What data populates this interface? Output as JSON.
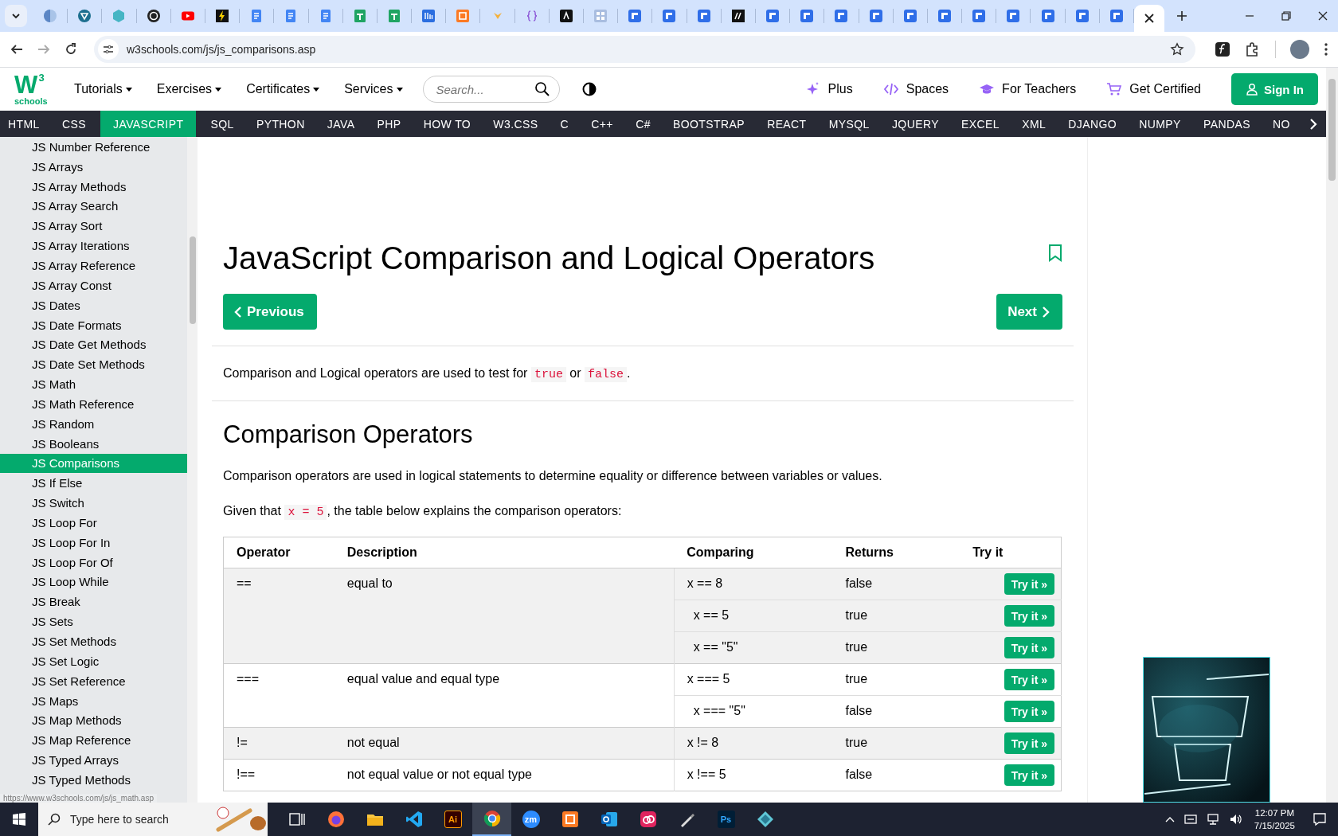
{
  "browser": {
    "tabs": [
      {
        "kind": "globe",
        "selected": false
      },
      {
        "kind": "vpn",
        "selected": false
      },
      {
        "kind": "hex",
        "selected": false
      },
      {
        "kind": "openai",
        "selected": false
      },
      {
        "kind": "youtube",
        "selected": false
      },
      {
        "kind": "bolt",
        "selected": false
      },
      {
        "kind": "doc",
        "selected": false
      },
      {
        "kind": "doc",
        "selected": false
      },
      {
        "kind": "doc",
        "selected": false
      },
      {
        "kind": "sheet",
        "selected": false
      },
      {
        "kind": "sheet",
        "selected": false
      },
      {
        "kind": "mblue",
        "selected": false
      },
      {
        "kind": "xampp",
        "selected": false
      },
      {
        "kind": "fox",
        "selected": false
      },
      {
        "kind": "braces",
        "selected": false
      },
      {
        "kind": "aiblack",
        "selected": false
      },
      {
        "kind": "repo",
        "selected": false
      },
      {
        "kind": "form",
        "selected": false
      },
      {
        "kind": "form",
        "selected": false
      },
      {
        "kind": "form",
        "selected": false
      },
      {
        "kind": "mblack",
        "selected": false
      },
      {
        "kind": "form",
        "selected": false
      },
      {
        "kind": "form",
        "selected": false
      },
      {
        "kind": "form",
        "selected": false
      },
      {
        "kind": "form",
        "selected": false
      },
      {
        "kind": "form",
        "selected": false
      },
      {
        "kind": "form",
        "selected": false
      },
      {
        "kind": "form",
        "selected": false
      },
      {
        "kind": "form",
        "selected": false
      },
      {
        "kind": "form",
        "selected": false
      },
      {
        "kind": "form",
        "selected": false
      },
      {
        "kind": "form",
        "selected": false
      },
      {
        "kind": "blank",
        "selected": true
      }
    ],
    "url": "w3schools.com/js/js_comparisons.asp"
  },
  "site_header": {
    "logo": {
      "letter": "W",
      "superscript": "3",
      "wordmark": "schools"
    },
    "menus": [
      "Tutorials",
      "Exercises",
      "Certificates",
      "Services"
    ],
    "search": {
      "placeholder": "Search..."
    },
    "links": [
      {
        "kind": "plus",
        "label": "Plus"
      },
      {
        "kind": "spaces",
        "label": "Spaces"
      },
      {
        "kind": "teachers",
        "label": "For Teachers"
      },
      {
        "kind": "certified",
        "label": "Get Certified"
      }
    ],
    "sign_in": "Sign In"
  },
  "topnav": [
    {
      "label": "HTML",
      "selected": false
    },
    {
      "label": "CSS",
      "selected": false
    },
    {
      "label": "JAVASCRIPT",
      "selected": true
    },
    {
      "label": "SQL",
      "selected": false
    },
    {
      "label": "PYTHON",
      "selected": false
    },
    {
      "label": "JAVA",
      "selected": false
    },
    {
      "label": "PHP",
      "selected": false
    },
    {
      "label": "HOW TO",
      "selected": false
    },
    {
      "label": "W3.CSS",
      "selected": false
    },
    {
      "label": "C",
      "selected": false
    },
    {
      "label": "C++",
      "selected": false
    },
    {
      "label": "C#",
      "selected": false
    },
    {
      "label": "BOOTSTRAP",
      "selected": false
    },
    {
      "label": "REACT",
      "selected": false
    },
    {
      "label": "MYSQL",
      "selected": false
    },
    {
      "label": "JQUERY",
      "selected": false
    },
    {
      "label": "EXCEL",
      "selected": false
    },
    {
      "label": "XML",
      "selected": false
    },
    {
      "label": "DJANGO",
      "selected": false
    },
    {
      "label": "NUMPY",
      "selected": false
    },
    {
      "label": "PANDAS",
      "selected": false
    },
    {
      "label": "NO",
      "selected": false
    }
  ],
  "sidebar": [
    {
      "label": "JS Number Reference",
      "selected": false
    },
    {
      "label": "JS Arrays",
      "selected": false
    },
    {
      "label": "JS Array Methods",
      "selected": false
    },
    {
      "label": "JS Array Search",
      "selected": false
    },
    {
      "label": "JS Array Sort",
      "selected": false
    },
    {
      "label": "JS Array Iterations",
      "selected": false
    },
    {
      "label": "JS Array Reference",
      "selected": false
    },
    {
      "label": "JS Array Const",
      "selected": false
    },
    {
      "label": "JS Dates",
      "selected": false
    },
    {
      "label": "JS Date Formats",
      "selected": false
    },
    {
      "label": "JS Date Get Methods",
      "selected": false
    },
    {
      "label": "JS Date Set Methods",
      "selected": false
    },
    {
      "label": "JS Math",
      "selected": false
    },
    {
      "label": "JS Math Reference",
      "selected": false
    },
    {
      "label": "JS Random",
      "selected": false
    },
    {
      "label": "JS Booleans",
      "selected": false
    },
    {
      "label": "JS Comparisons",
      "selected": true
    },
    {
      "label": "JS If Else",
      "selected": false
    },
    {
      "label": "JS Switch",
      "selected": false
    },
    {
      "label": "JS Loop For",
      "selected": false
    },
    {
      "label": "JS Loop For In",
      "selected": false
    },
    {
      "label": "JS Loop For Of",
      "selected": false
    },
    {
      "label": "JS Loop While",
      "selected": false
    },
    {
      "label": "JS Break",
      "selected": false
    },
    {
      "label": "JS Sets",
      "selected": false
    },
    {
      "label": "JS Set Methods",
      "selected": false
    },
    {
      "label": "JS Set Logic",
      "selected": false
    },
    {
      "label": "JS Set Reference",
      "selected": false
    },
    {
      "label": "JS Maps",
      "selected": false
    },
    {
      "label": "JS Map Methods",
      "selected": false
    },
    {
      "label": "JS Map Reference",
      "selected": false
    },
    {
      "label": "JS Typed Arrays",
      "selected": false
    },
    {
      "label": "JS Typed Methods",
      "selected": false
    }
  ],
  "article": {
    "title": "JavaScript Comparison and Logical Operators",
    "previous": "Previous",
    "next": "Next",
    "intro": [
      {
        "kind": "text",
        "text": "Comparison and Logical operators are used to test for "
      },
      {
        "kind": "code",
        "text": "true"
      },
      {
        "kind": "text",
        "text": " or "
      },
      {
        "kind": "code",
        "text": "false"
      },
      {
        "kind": "text",
        "text": "."
      }
    ],
    "heading": "Comparison Operators",
    "paragraph": "Comparison operators are used in logical statements to determine equality or difference between variables or values.",
    "given": [
      {
        "kind": "text",
        "text": "Given that "
      },
      {
        "kind": "code",
        "text": "x = 5"
      },
      {
        "kind": "text",
        "text": ", the table below explains the comparison operators:"
      }
    ],
    "table": {
      "columns": [
        "Operator",
        "Description",
        "Comparing",
        "Returns",
        "Try it"
      ],
      "groups": [
        {
          "operator": "==",
          "description": "equal to",
          "rows": [
            {
              "comparing": "x == 8",
              "returns": "false",
              "button": "Try it »"
            },
            {
              "comparing": "x == 5",
              "returns": "true",
              "button": "Try it »"
            },
            {
              "comparing": "x == \"5\"",
              "returns": "true",
              "button": "Try it »"
            }
          ]
        },
        {
          "operator": "===",
          "description": "equal value and equal type",
          "rows": [
            {
              "comparing": "x === 5",
              "returns": "true",
              "button": "Try it »"
            },
            {
              "comparing": "x === \"5\"",
              "returns": "false",
              "button": "Try it »"
            }
          ]
        },
        {
          "operator": "!=",
          "description": "not equal",
          "rows": [
            {
              "comparing": "x != 8",
              "returns": "true",
              "button": "Try it »"
            }
          ]
        },
        {
          "operator": "!==",
          "description": "not equal value or not equal type",
          "rows": [
            {
              "comparing": "x !== 5",
              "returns": "false",
              "button": "Try it »"
            }
          ]
        }
      ]
    }
  },
  "status_url": "https://www.w3schools.com/js/js_math.asp",
  "taskbar": {
    "search_placeholder": "Type here to search",
    "apps": [
      {
        "kind": "taskview",
        "active": false
      },
      {
        "kind": "firefox",
        "active": false
      },
      {
        "kind": "explorer",
        "active": false
      },
      {
        "kind": "vscode",
        "active": false
      },
      {
        "kind": "illustrator",
        "label": "Ai",
        "active": false
      },
      {
        "kind": "chrome",
        "active": true
      },
      {
        "kind": "zoom",
        "label": "zm",
        "active": false
      },
      {
        "kind": "xampp",
        "active": false
      },
      {
        "kind": "outlook",
        "active": false
      },
      {
        "kind": "creative",
        "active": false
      },
      {
        "kind": "pen",
        "active": false
      },
      {
        "kind": "photoshop",
        "label": "Ps",
        "active": false
      },
      {
        "kind": "diamond",
        "active": false
      }
    ],
    "time": "12:07 PM",
    "date": "7/15/2025"
  }
}
